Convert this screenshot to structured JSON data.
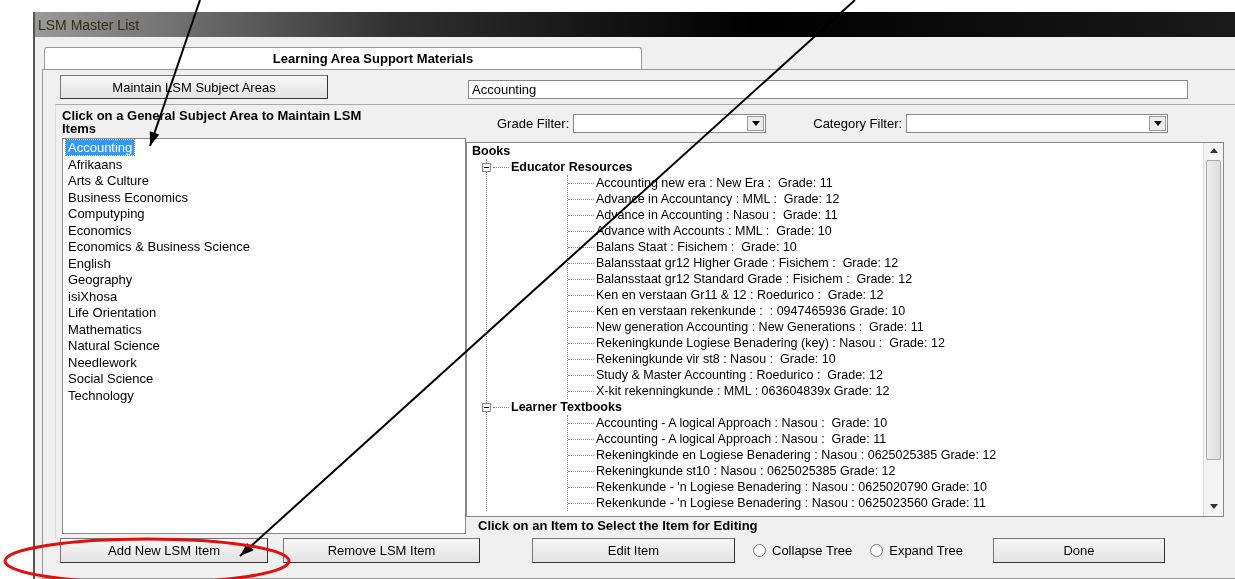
{
  "window": {
    "title": "LSM Master List"
  },
  "tab": {
    "label": "Learning Area Support Materials"
  },
  "maintain_button": "Maintain LSM Subject Areas",
  "subject_field": {
    "value": "Accounting"
  },
  "list_heading": "Click on a General Subject Area to Maintain LSM Items",
  "grade_filter": {
    "label": "Grade Filter:"
  },
  "category_filter": {
    "label": "Category Filter:"
  },
  "subject_areas": [
    {
      "label": "Accounting",
      "selected": true
    },
    {
      "label": "Afrikaans",
      "selected": false
    },
    {
      "label": "Arts & Culture",
      "selected": false
    },
    {
      "label": "Business Economics",
      "selected": false
    },
    {
      "label": "Computyping",
      "selected": false
    },
    {
      "label": "Economics",
      "selected": false
    },
    {
      "label": "Economics & Business Science",
      "selected": false
    },
    {
      "label": "English",
      "selected": false
    },
    {
      "label": "Geography",
      "selected": false
    },
    {
      "label": "isiXhosa",
      "selected": false
    },
    {
      "label": "Life Orientation",
      "selected": false
    },
    {
      "label": "Mathematics",
      "selected": false
    },
    {
      "label": "Natural Science",
      "selected": false
    },
    {
      "label": "Needlework",
      "selected": false
    },
    {
      "label": "Social Science",
      "selected": false
    },
    {
      "label": "Technology",
      "selected": false
    }
  ],
  "tree": {
    "label": "Books",
    "children": [
      {
        "label": "Educator Resources",
        "expanded": true,
        "children": [
          {
            "label": "Accounting new era : New Era :  Grade: 11"
          },
          {
            "label": "Advance in Accountancy : MML :  Grade: 12"
          },
          {
            "label": "Advance in Accounting : Nasou :  Grade: 11"
          },
          {
            "label": "Advance with Accounts : MML :  Grade: 10"
          },
          {
            "label": "Balans Staat : Fisichem :  Grade: 10"
          },
          {
            "label": "Balansstaat gr12 Higher Grade : Fisichem :  Grade: 12"
          },
          {
            "label": "Balansstaat gr12 Standard Grade : Fisichem :  Grade: 12"
          },
          {
            "label": "Ken en verstaan Gr11 & 12 : Roedurico :  Grade: 12"
          },
          {
            "label": "Ken en verstaan rekenkunde :  : 0947465936 Grade: 10"
          },
          {
            "label": "New generation Accounting : New Generations :  Grade: 11"
          },
          {
            "label": "Rekeningkunde Logiese Benadering (key) : Nasou :  Grade: 12"
          },
          {
            "label": "Rekeningkunde vir st8 : Nasou :  Grade: 10"
          },
          {
            "label": "Study & Master Accounting : Roedurico :  Grade: 12"
          },
          {
            "label": "X-kit rekenningkunde : MML : 063604839x Grade: 12"
          }
        ]
      },
      {
        "label": "Learner Textbooks",
        "expanded": true,
        "children": [
          {
            "label": "Accounting - A logical Approach : Nasou :  Grade: 10"
          },
          {
            "label": "Accounting - A logical Approach : Nasou :  Grade: 11"
          },
          {
            "label": "Rekeningkinde en Logiese Benadering : Nasou : 0625025385 Grade: 12"
          },
          {
            "label": "Rekeningkunde st10 : Nasou : 0625025385 Grade: 12"
          },
          {
            "label": "Rekenkunde - 'n Logiese Benadering : Nasou : 0625020790 Grade: 10"
          },
          {
            "label": "Rekenkunde - 'n Logiese Benadering : Nasou : 0625023560 Grade: 11"
          }
        ]
      }
    ]
  },
  "tree_hint": "Click on an Item to Select the Item for Editing",
  "buttons": {
    "add": "Add New LSM Item",
    "remove": "Remove LSM Item",
    "edit": "Edit Item",
    "done": "Done"
  },
  "tree_options": [
    {
      "label": "Collapse Tree",
      "selected": false
    },
    {
      "label": "Expand Tree",
      "selected": false
    }
  ]
}
